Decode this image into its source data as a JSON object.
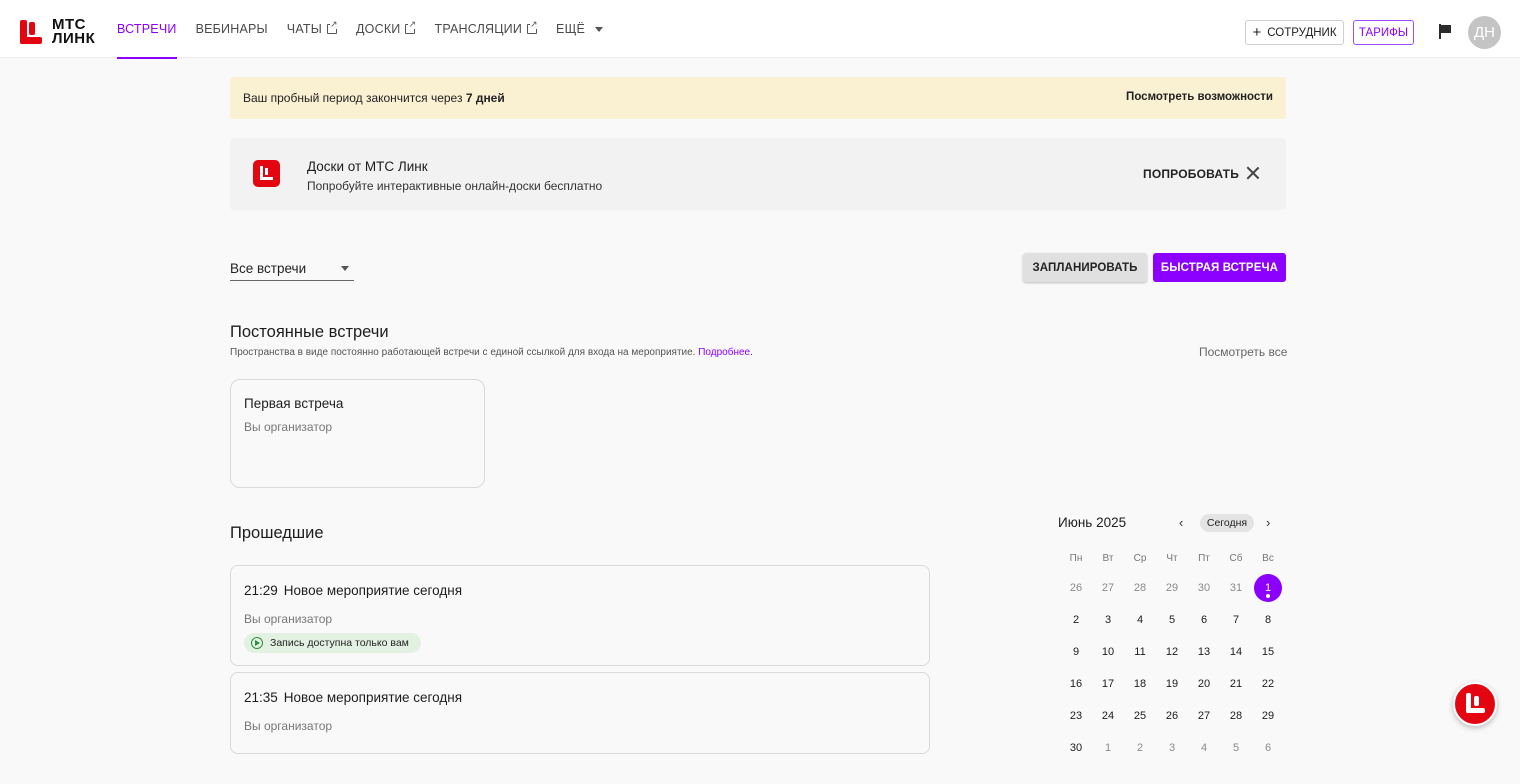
{
  "brand": {
    "line1": "МТС",
    "line2": "ЛИНК"
  },
  "nav": [
    {
      "label": "ВСТРЕЧИ",
      "active": true,
      "external": false
    },
    {
      "label": "ВЕБИНАРЫ",
      "active": false,
      "external": false
    },
    {
      "label": "ЧАТЫ",
      "active": false,
      "external": true
    },
    {
      "label": "ДОСКИ",
      "active": false,
      "external": true
    },
    {
      "label": "ТРАНСЛЯЦИИ",
      "active": false,
      "external": true
    },
    {
      "label": "ЕЩЁ",
      "active": false,
      "external": false,
      "dropdown": true
    }
  ],
  "header": {
    "employee_button": "СОТРУДНИК",
    "employee_icon": "plus-icon",
    "tariffs_button": "ТАРИФЫ",
    "flag_icon": "flag-icon",
    "avatar_initials": "ДН"
  },
  "trial": {
    "text": "Ваш пробный период закончится через",
    "days": "7 дней",
    "link": "Посмотреть возможности"
  },
  "promo": {
    "title": "Доски от МТС Линк",
    "subtitle": "Попробуйте интерактивные онлайн-доски бесплатно",
    "try_button": "ПОПРОБОВАТЬ",
    "close_icon": "close-icon"
  },
  "filter": {
    "selected": "Все встречи"
  },
  "actions": {
    "plan": "ЗАПЛАНИРОВАТЬ",
    "quick": "БЫСТРАЯ ВСТРЕЧА"
  },
  "permanent": {
    "title": "Постоянные встречи",
    "description": "Пространства в виде постоянно работающей встречи с единой ссылкой для входа на мероприятие.",
    "more_link": "Подробнее.",
    "view_all": "Посмотреть все",
    "cards": [
      {
        "title": "Первая встреча",
        "role": "Вы организатор"
      }
    ]
  },
  "past": {
    "title": "Прошедшие",
    "events": [
      {
        "time": "21:29",
        "title": "Новое мероприятие сегодня",
        "role": "Вы организатор",
        "badge": "Запись доступна только вам"
      },
      {
        "time": "21:35",
        "title": "Новое мероприятие сегодня",
        "role": "Вы организатор"
      }
    ]
  },
  "calendar": {
    "month": "Июнь 2025",
    "today_button": "Сегодня",
    "weekdays": [
      "Пн",
      "Вт",
      "Ср",
      "Чт",
      "Пт",
      "Сб",
      "Вс"
    ],
    "weeks": [
      [
        "26",
        "27",
        "28",
        "29",
        "30",
        "31",
        "1"
      ],
      [
        "2",
        "3",
        "4",
        "5",
        "6",
        "7",
        "8"
      ],
      [
        "9",
        "10",
        "11",
        "12",
        "13",
        "14",
        "15"
      ],
      [
        "16",
        "17",
        "18",
        "19",
        "20",
        "21",
        "22"
      ],
      [
        "23",
        "24",
        "25",
        "26",
        "27",
        "28",
        "29"
      ],
      [
        "30",
        "1",
        "2",
        "3",
        "4",
        "5",
        "6"
      ]
    ],
    "selected_day": "1"
  },
  "colors": {
    "accent": "#8b00ff",
    "brand_red": "#e30611",
    "banner": "#faf0d2"
  }
}
